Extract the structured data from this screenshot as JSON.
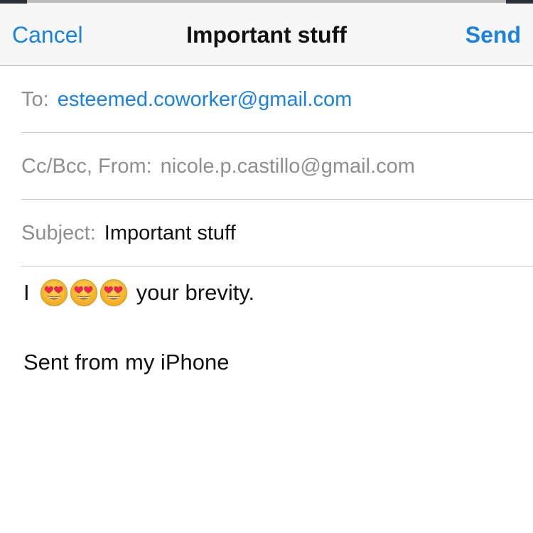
{
  "navbar": {
    "cancel_label": "Cancel",
    "title": "Important stuff",
    "send_label": "Send"
  },
  "compose": {
    "to_label": "To:",
    "to_value": "esteemed.coworker@gmail.com",
    "ccbcc_label": "Cc/Bcc, From:",
    "from_value": "nicole.p.castillo@gmail.com",
    "subject_label": "Subject:",
    "subject_value": "Important stuff"
  },
  "body": {
    "prefix": "I",
    "emojis": [
      "heart-eyes-emoji",
      "heart-eyes-emoji",
      "heart-eyes-emoji"
    ],
    "suffix": "your brevity.",
    "signature": "Sent from my iPhone"
  },
  "colors": {
    "accent": "#1a82e2",
    "label_gray": "#8e8e93",
    "navbar_bg": "#f7f7f7",
    "separator": "#c8c7cc"
  }
}
